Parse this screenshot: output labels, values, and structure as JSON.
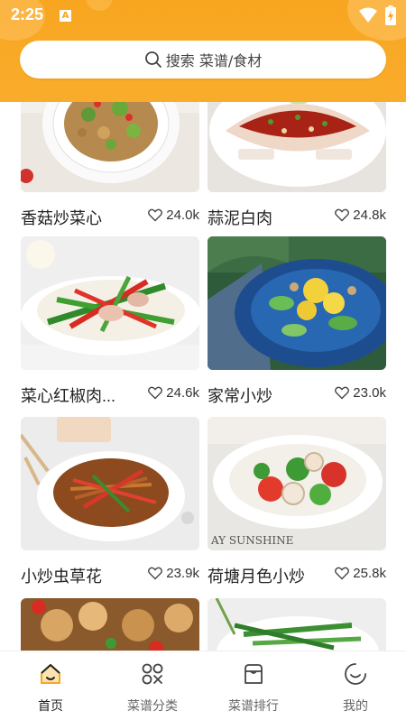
{
  "status": {
    "time": "2:25",
    "notif_glyph": "A"
  },
  "search": {
    "placeholder": "搜索 菜谱/食材"
  },
  "recipes": [
    {
      "title": "香菇炒菜心",
      "likes": "24.0k"
    },
    {
      "title": "蒜泥白肉",
      "likes": "24.8k"
    },
    {
      "title": "菜心红椒肉...",
      "likes": "24.6k"
    },
    {
      "title": "家常小炒",
      "likes": "23.0k"
    },
    {
      "title": "小炒虫草花",
      "likes": "23.9k"
    },
    {
      "title": "荷塘月色小炒",
      "likes": "25.8k"
    }
  ],
  "image_text": {
    "sunshine": "AY SUNSHINE"
  },
  "tabs": [
    {
      "label": "首页",
      "icon": "home-icon",
      "active": true
    },
    {
      "label": "菜谱分类",
      "icon": "category-icon",
      "active": false
    },
    {
      "label": "菜谱排行",
      "icon": "ranking-icon",
      "active": false
    },
    {
      "label": "我的",
      "icon": "profile-icon",
      "active": false
    }
  ],
  "colors": {
    "accent": "#F8A620",
    "active_icon": "#F8A620"
  }
}
